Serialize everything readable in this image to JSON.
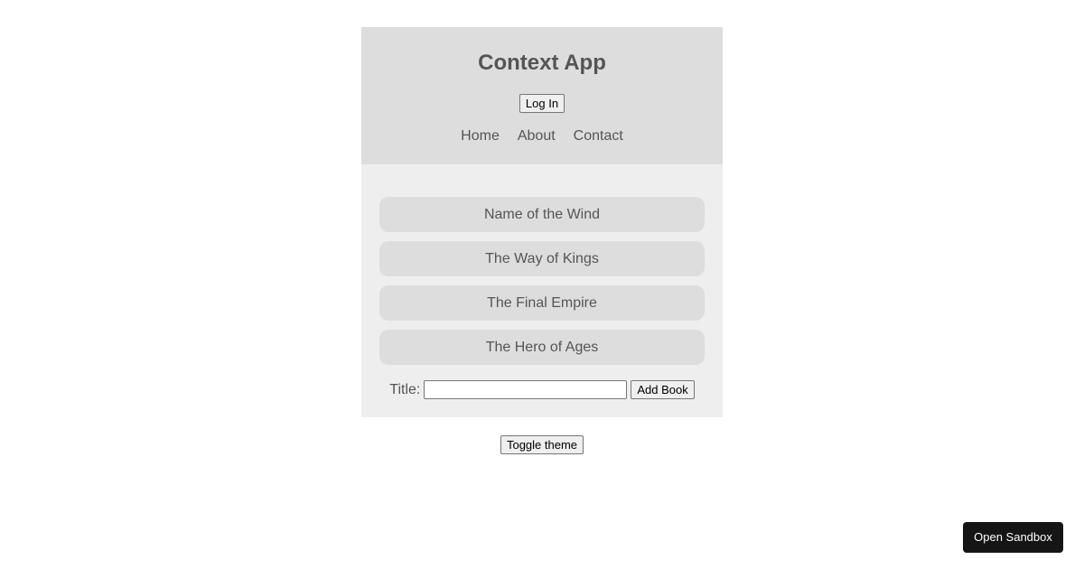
{
  "app": {
    "title": "Context App",
    "login_label": "Log In"
  },
  "nav": {
    "links": [
      "Home",
      "About",
      "Contact"
    ]
  },
  "books": {
    "items": [
      "Name of the Wind",
      "The Way of Kings",
      "The Final Empire",
      "The Hero of Ages"
    ]
  },
  "form": {
    "title_label": "Title:",
    "title_value": "",
    "add_label": "Add Book"
  },
  "theme": {
    "toggle_label": "Toggle theme"
  },
  "sandbox": {
    "open_label": "Open Sandbox"
  },
  "colors": {
    "navbar_bg": "#dddddd",
    "section_bg": "#eeeeee",
    "text": "#555555",
    "sandbox_bg": "#151515"
  }
}
